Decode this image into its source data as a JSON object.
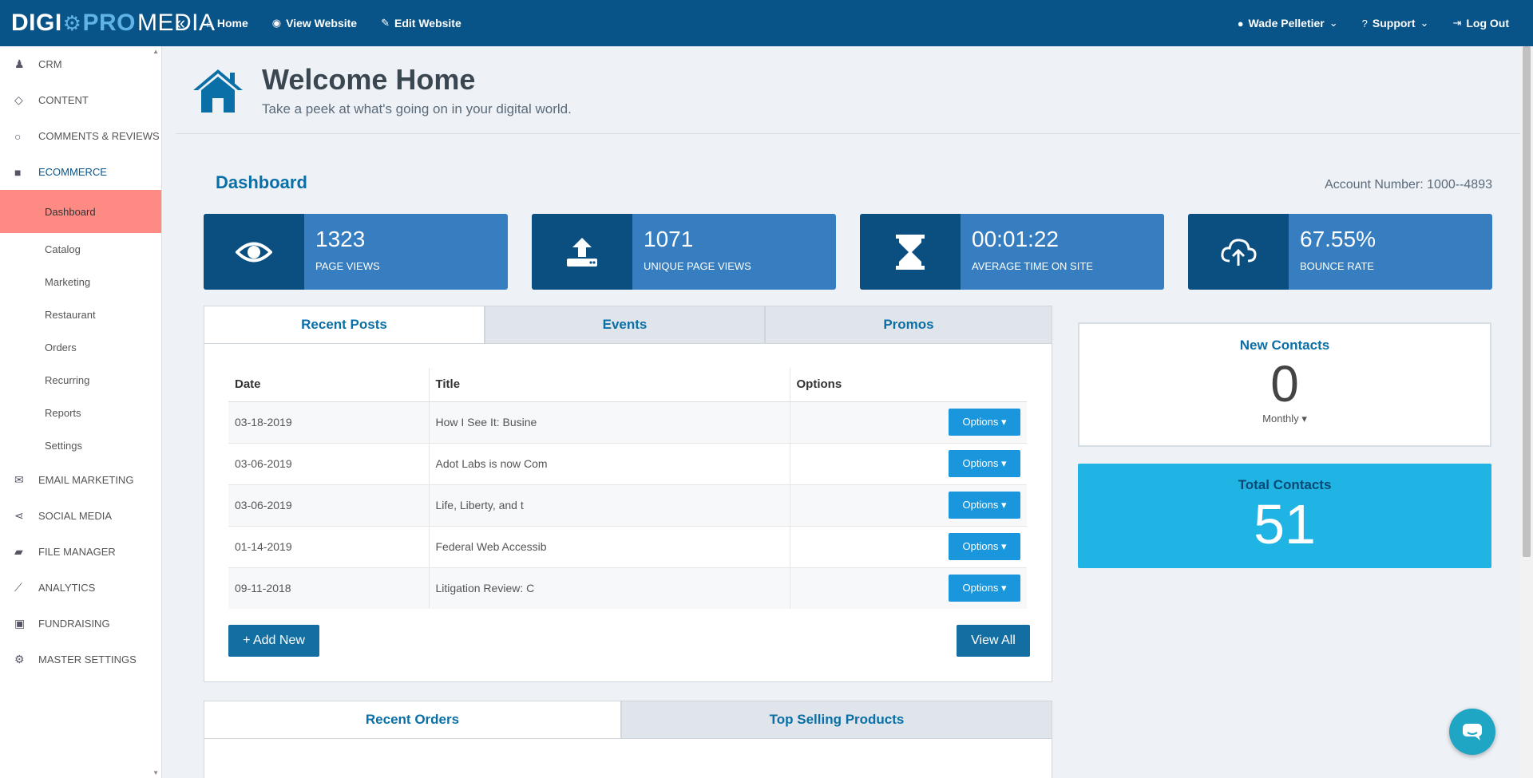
{
  "brand": {
    "part1": "DIGI",
    "part2": "PRO",
    "part3": "MEDIA"
  },
  "topnav": [
    {
      "label": "Home",
      "icon": "home-icon"
    },
    {
      "label": "View Website",
      "icon": "eye-icon"
    },
    {
      "label": "Edit Website",
      "icon": "edit-icon"
    }
  ],
  "user": {
    "name": "Wade Pelletier",
    "support": "Support",
    "logout": "Log Out"
  },
  "sidebar": {
    "items": [
      {
        "label": "CRM",
        "icon": "users-icon"
      },
      {
        "label": "CONTENT",
        "icon": "diamond-icon"
      },
      {
        "label": "COMMENTS & REVIEWS",
        "icon": "comment-icon"
      },
      {
        "label": "ECOMMERCE",
        "icon": "gift-icon"
      }
    ],
    "sub": [
      "Dashboard",
      "Catalog",
      "Marketing",
      "Restaurant",
      "Orders",
      "Recurring",
      "Reports",
      "Settings"
    ],
    "items2": [
      {
        "label": "EMAIL MARKETING",
        "icon": "envelope-icon"
      },
      {
        "label": "SOCIAL MEDIA",
        "icon": "share-icon"
      },
      {
        "label": "FILE MANAGER",
        "icon": "folder-icon"
      },
      {
        "label": "ANALYTICS",
        "icon": "line-chart-icon"
      },
      {
        "label": "FUNDRAISING",
        "icon": "money-icon"
      },
      {
        "label": "MASTER SETTINGS",
        "icon": "gear-icon"
      }
    ]
  },
  "welcome": {
    "title": "Welcome Home",
    "subtitle": "Take a peek at what's going on in your digital world."
  },
  "dashboard": {
    "title": "Dashboard",
    "account": "Account Number: 1000--4893"
  },
  "stats": [
    {
      "value": "1323",
      "label": "PAGE VIEWS",
      "icon": "eye-icon"
    },
    {
      "value": "1071",
      "label": "UNIQUE PAGE VIEWS",
      "icon": "upload-icon"
    },
    {
      "value": "00:01:22",
      "label": "AVERAGE TIME ON SITE",
      "icon": "hourglass-icon"
    },
    {
      "value": "67.55%",
      "label": "BOUNCE RATE",
      "icon": "cloud-upload-icon"
    }
  ],
  "post_tabs": [
    "Recent Posts",
    "Events",
    "Promos"
  ],
  "posts_table": {
    "headers": [
      "Date",
      "Title",
      "Options"
    ],
    "rows": [
      {
        "date": "03-18-2019",
        "title": "How I See It: Busine",
        "option": "Options"
      },
      {
        "date": "03-06-2019",
        "title": "Adot Labs is now Com",
        "option": "Options"
      },
      {
        "date": "03-06-2019",
        "title": "Life, Liberty, and t",
        "option": "Options"
      },
      {
        "date": "01-14-2019",
        "title": "Federal Web Accessib",
        "option": "Options"
      },
      {
        "date": "09-11-2018",
        "title": "Litigation Review: C",
        "option": "Options"
      }
    ]
  },
  "buttons": {
    "add_new": "+ Add New",
    "view_all": "View All"
  },
  "order_tabs": [
    "Recent Orders",
    "Top Selling Products"
  ],
  "contacts": {
    "new_title": "New Contacts",
    "new_value": "0",
    "period": "Monthly",
    "total_title": "Total Contacts",
    "total_value": "51"
  },
  "colors": {
    "nav": "#085387",
    "stat": "#367ebf",
    "accent": "#1fb4e4",
    "active": "#fe8a84"
  }
}
